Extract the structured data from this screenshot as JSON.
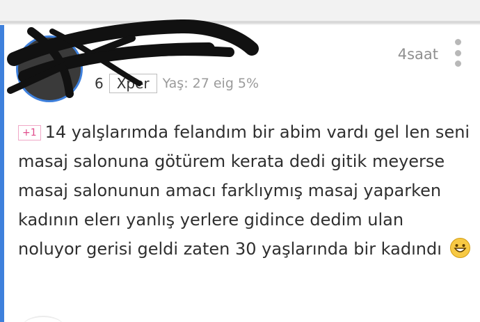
{
  "post": {
    "time": "4saat",
    "level": "6",
    "rank": "Xper",
    "age": "Yaş: 27 eig 5%",
    "plus_badge": "+1",
    "text": "14 yalşlarımda felandım bir abim vardı gel len seni masaj salonuna götürem kerata dedi gitik meyerse masaj salonunun amacı farklıymış masaj yaparken kadının elerı yanlış yerlere gidince dedim ulan noluyor gerisi geldi zaten 30 yaşlarında bir kadındı"
  },
  "icons": {
    "more": "vertical-ellipsis-icon",
    "emoji": "grinning-face-icon"
  },
  "colors": {
    "accent": "#3e80dc",
    "plus": "#e04b8b",
    "text": "#2f2f2f",
    "muted": "#8f8f8f"
  }
}
